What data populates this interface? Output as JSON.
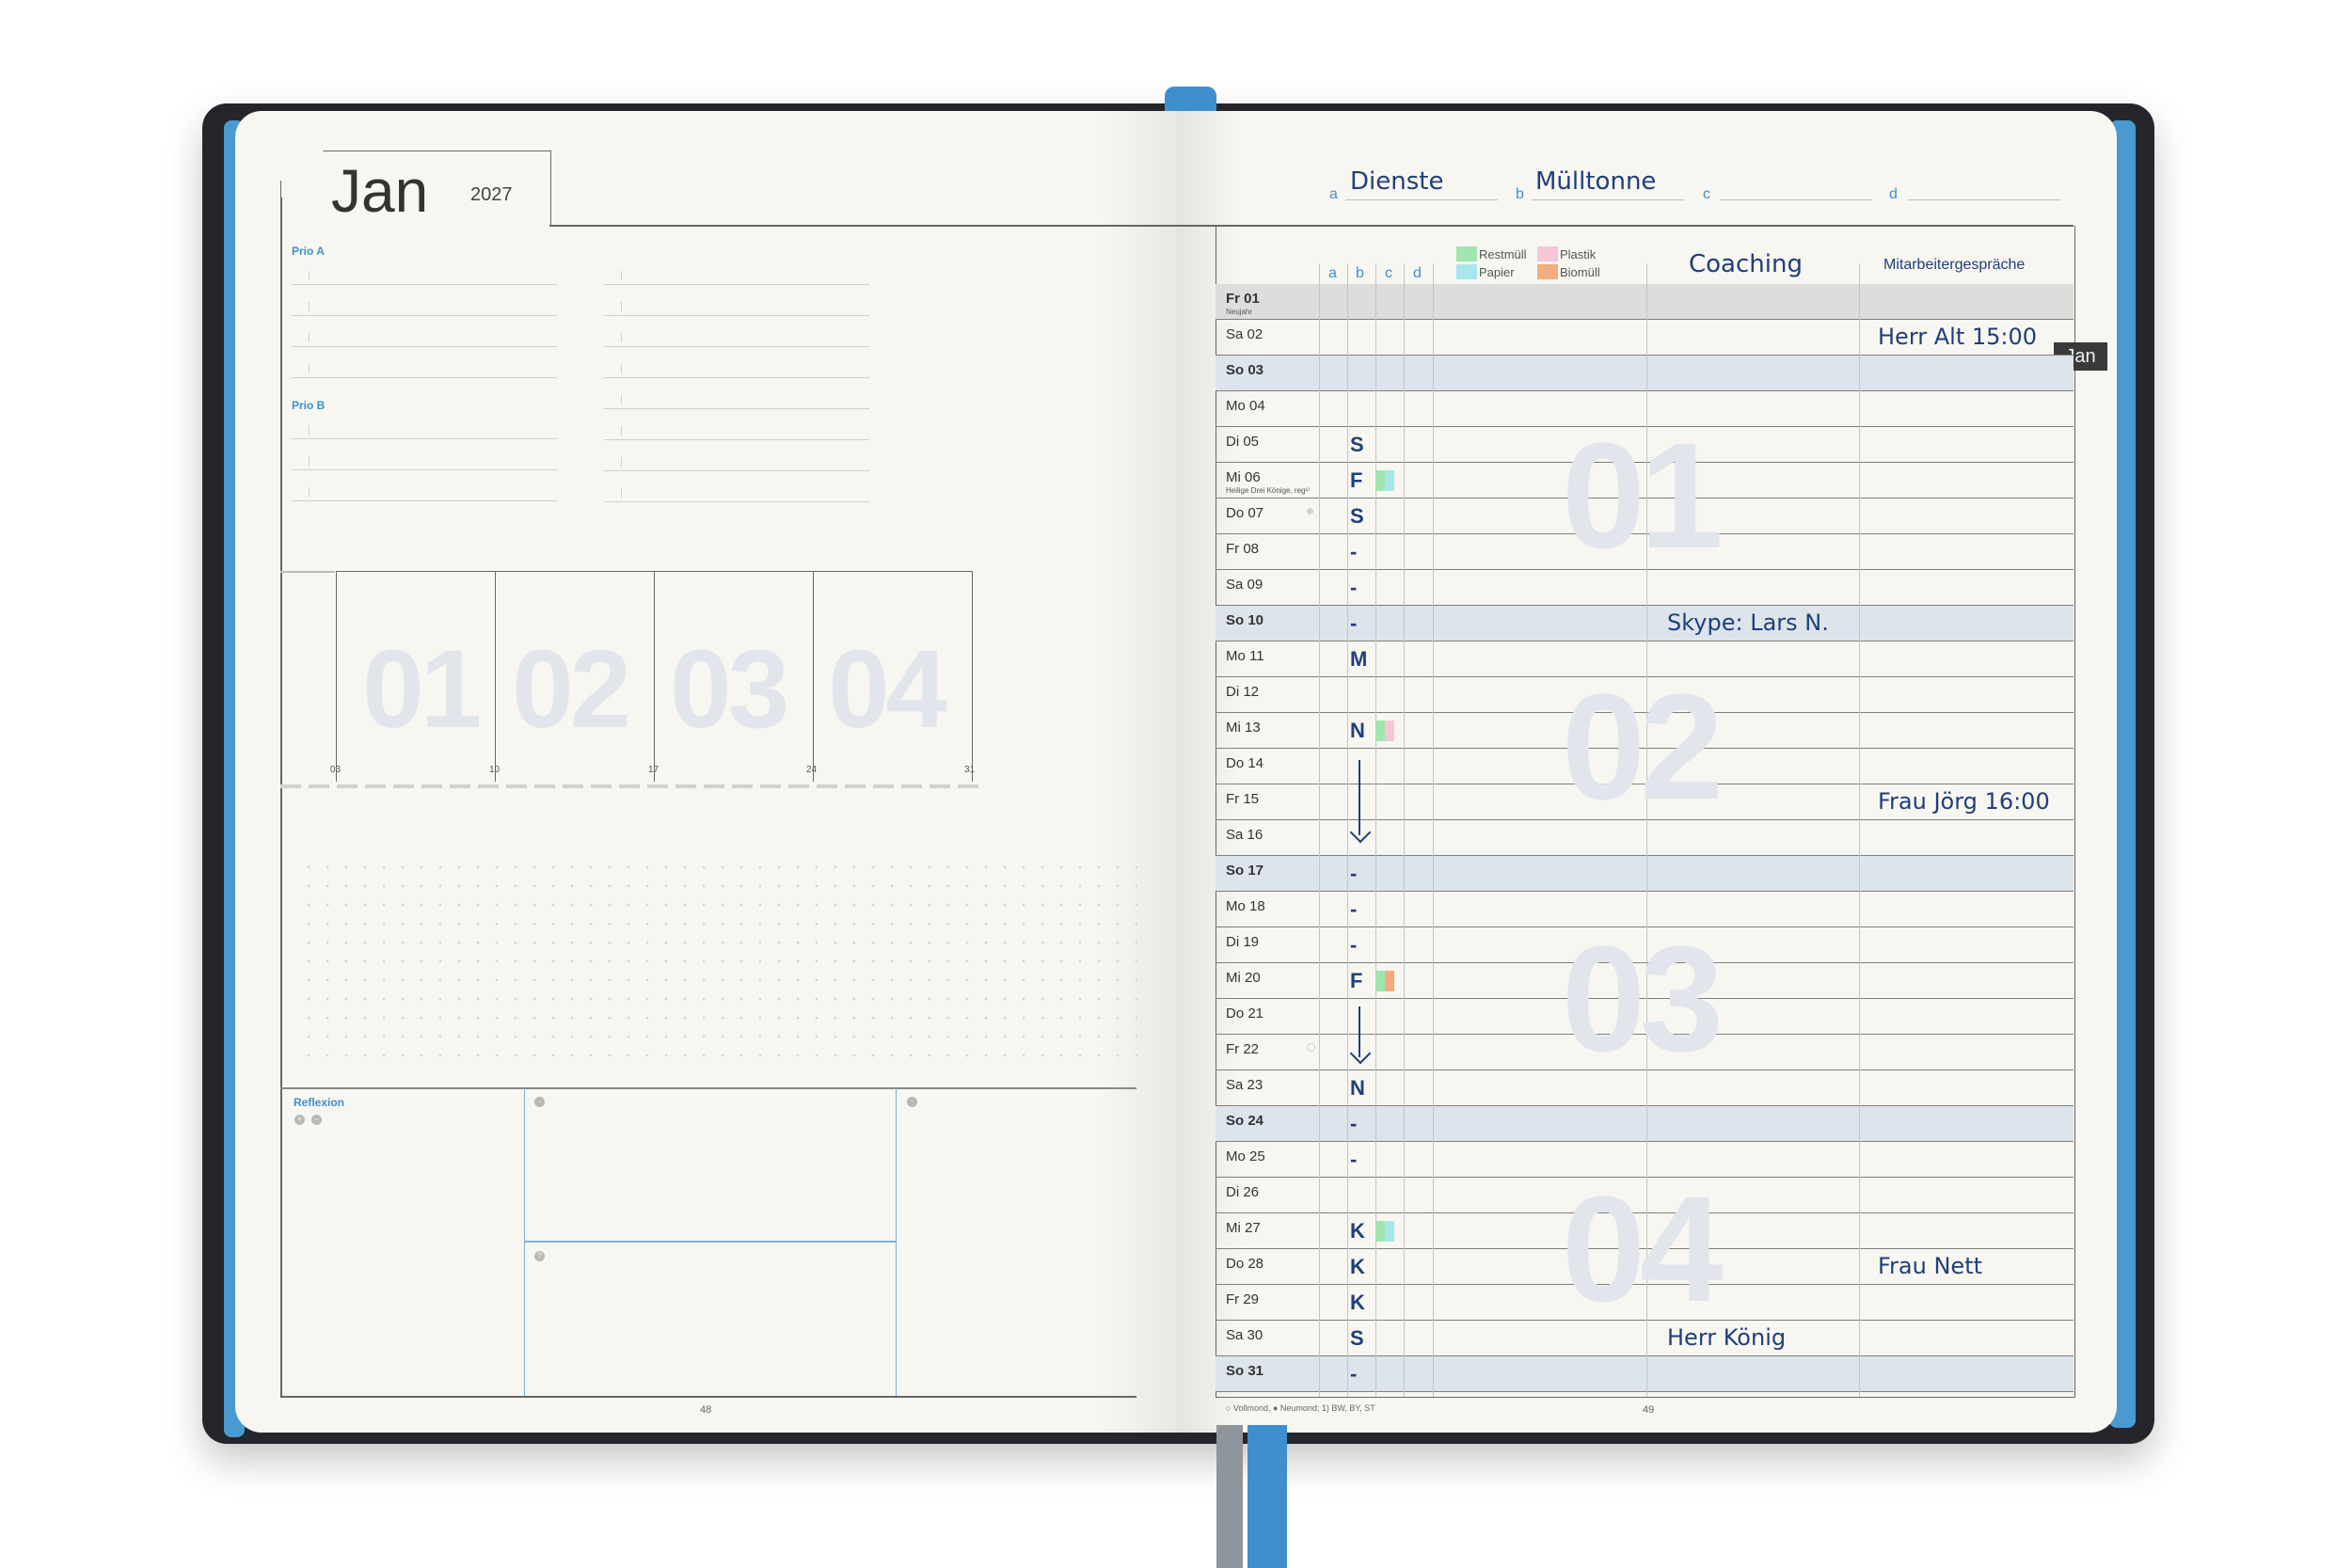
{
  "left_page": {
    "month": "Jan",
    "year": "2027",
    "prio_a": "Prio A",
    "prio_b": "Prio B",
    "week_numbers": [
      "01",
      "02",
      "03",
      "04"
    ],
    "week_dates": [
      "03",
      "10",
      "17",
      "24",
      "31"
    ],
    "reflexion": "Reflexion",
    "page_number": "48"
  },
  "right_page": {
    "header": {
      "a_label": "a",
      "a_value": "Dienste",
      "b_label": "b",
      "b_value": "Mülltonne",
      "c_label": "c",
      "c_value": "",
      "d_label": "d",
      "d_value": ""
    },
    "column_letters": [
      "a",
      "b",
      "c",
      "d"
    ],
    "legend": [
      {
        "label": "Restmüll",
        "color": "#9fe6b0"
      },
      {
        "label": "Plastik",
        "color": "#f5c6d8"
      },
      {
        "label": "Papier",
        "color": "#a8e6ee"
      },
      {
        "label": "Biomüll",
        "color": "#f3ad7c"
      }
    ],
    "column_titles": {
      "coaching": "Coaching",
      "mitarbeiter": "Mitarbeitergespräche"
    },
    "month_tab": "Jan",
    "days": [
      {
        "label": "Fr 01",
        "note": "Neujahr",
        "entry": "",
        "type": "holiday"
      },
      {
        "label": "Sa 02",
        "note": "",
        "entry": "",
        "type": "normal"
      },
      {
        "label": "So 03",
        "note": "",
        "entry": "",
        "type": "weekend"
      },
      {
        "label": "Mo 04",
        "note": "",
        "entry": "",
        "type": "normal"
      },
      {
        "label": "Di 05",
        "note": "",
        "entry": "S",
        "type": "normal"
      },
      {
        "label": "Mi 06",
        "note": "Heilige Drei Könige, reg¹⁾",
        "entry": "F",
        "type": "normal"
      },
      {
        "label": "Do 07",
        "note": "",
        "entry": "S",
        "type": "normal"
      },
      {
        "label": "Fr 08",
        "note": "",
        "entry": "-",
        "type": "normal"
      },
      {
        "label": "Sa 09",
        "note": "",
        "entry": "-",
        "type": "normal"
      },
      {
        "label": "So 10",
        "note": "",
        "entry": "-",
        "type": "weekend"
      },
      {
        "label": "Mo 11",
        "note": "",
        "entry": "M",
        "type": "normal"
      },
      {
        "label": "Di 12",
        "note": "",
        "entry": "",
        "type": "normal"
      },
      {
        "label": "Mi 13",
        "note": "",
        "entry": "N",
        "type": "normal"
      },
      {
        "label": "Do 14",
        "note": "",
        "entry": "",
        "type": "normal"
      },
      {
        "label": "Fr 15",
        "note": "",
        "entry": "",
        "type": "normal"
      },
      {
        "label": "Sa 16",
        "note": "",
        "entry": "",
        "type": "normal"
      },
      {
        "label": "So 17",
        "note": "",
        "entry": "-",
        "type": "weekend"
      },
      {
        "label": "Mo 18",
        "note": "",
        "entry": "-",
        "type": "normal"
      },
      {
        "label": "Di 19",
        "note": "",
        "entry": "-",
        "type": "normal"
      },
      {
        "label": "Mi 20",
        "note": "",
        "entry": "F",
        "type": "normal"
      },
      {
        "label": "Do 21",
        "note": "",
        "entry": "",
        "type": "normal"
      },
      {
        "label": "Fr 22",
        "note": "",
        "entry": "",
        "type": "normal"
      },
      {
        "label": "Sa 23",
        "note": "",
        "entry": "N",
        "type": "normal"
      },
      {
        "label": "So 24",
        "note": "",
        "entry": "-",
        "type": "weekend"
      },
      {
        "label": "Mo 25",
        "note": "",
        "entry": "-",
        "type": "normal"
      },
      {
        "label": "Di 26",
        "note": "",
        "entry": "",
        "type": "normal"
      },
      {
        "label": "Mi 27",
        "note": "",
        "entry": "K",
        "type": "normal"
      },
      {
        "label": "Do 28",
        "note": "",
        "entry": "K",
        "type": "normal"
      },
      {
        "label": "Fr 29",
        "note": "",
        "entry": "K",
        "type": "normal"
      },
      {
        "label": "Sa 30",
        "note": "",
        "entry": "S",
        "type": "normal"
      },
      {
        "label": "So 31",
        "note": "",
        "entry": "-",
        "type": "weekend"
      }
    ],
    "bin_marks": [
      {
        "day": "Mi 06",
        "colors": [
          "#9fe6b0",
          "#a8e6ee"
        ]
      },
      {
        "day": "Mi 13",
        "colors": [
          "#9fe6b0",
          "#f5c6d8"
        ]
      },
      {
        "day": "Mi 20",
        "colors": [
          "#9fe6b0",
          "#f3ad7c"
        ]
      },
      {
        "day": "Mi 27",
        "colors": [
          "#9fe6b0",
          "#a8e6ee"
        ]
      }
    ],
    "appointments": [
      {
        "day": "Sa 02",
        "column": "mitarbeiter",
        "text": "Herr Alt 15:00"
      },
      {
        "day": "So 10",
        "column": "coaching",
        "text": "Skype: Lars N."
      },
      {
        "day": "Fr 15",
        "column": "mitarbeiter",
        "text": "Frau Jörg 16:00"
      },
      {
        "day": "Do 28",
        "column": "mitarbeiter",
        "text": "Frau Nett"
      },
      {
        "day": "Sa 30",
        "column": "coaching",
        "text": "Herr König"
      }
    ],
    "week_numbers": [
      "01",
      "02",
      "03",
      "04"
    ],
    "footer": "○ Vollmond, ● Neumond;   1) BW, BY, ST",
    "page_number": "49"
  }
}
